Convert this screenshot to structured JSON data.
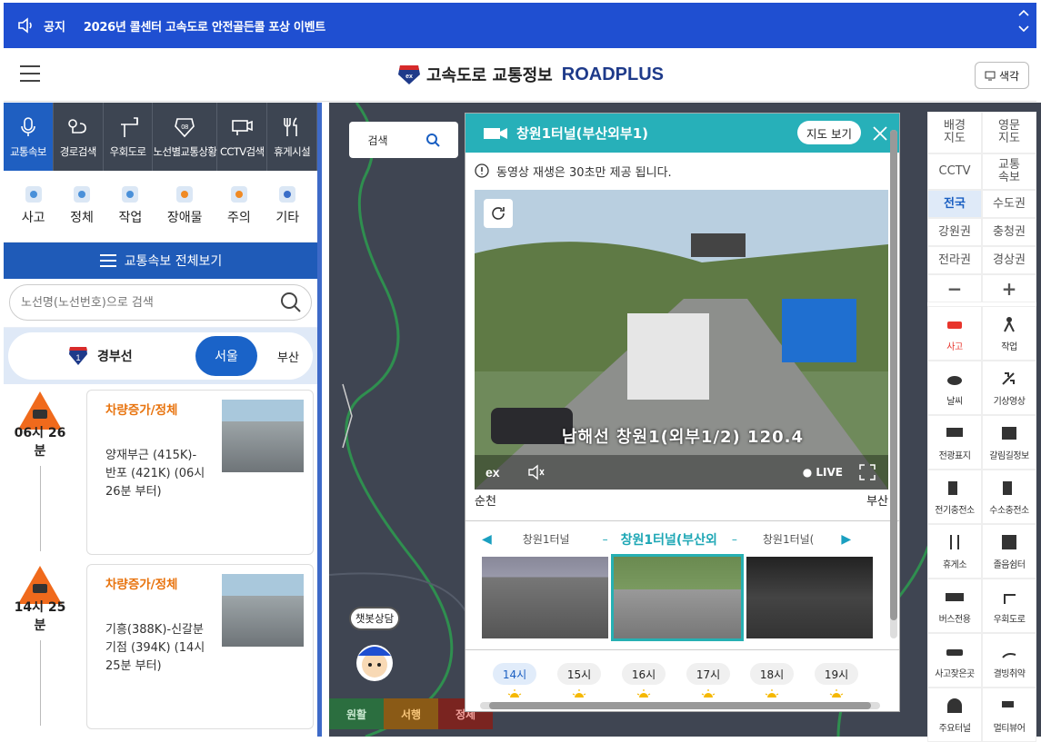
{
  "notice": {
    "label": "공지",
    "text": "2026년 콜센터 고속도로 안전골든콜 포상 이벤트"
  },
  "header": {
    "logo_text": "고속도로 교통정보",
    "logo_brand": "ROADPLUS",
    "color_button": "색각"
  },
  "tabs": [
    {
      "label": "교통속보",
      "icon": "mic-icon"
    },
    {
      "label": "경로검색",
      "icon": "route-icon"
    },
    {
      "label": "우회도로",
      "icon": "detour-icon"
    },
    {
      "label": "노선별교통상황",
      "icon": "route-shield-icon"
    },
    {
      "label": "CCTV검색",
      "icon": "cctv-icon"
    },
    {
      "label": "휴게시설",
      "icon": "restaurant-icon"
    }
  ],
  "types": [
    {
      "label": "사고",
      "color": "#4a90d9"
    },
    {
      "label": "정체",
      "color": "#4a90d9"
    },
    {
      "label": "작업",
      "color": "#4a90d9"
    },
    {
      "label": "장애물",
      "color": "#f08a24"
    },
    {
      "label": "주의",
      "color": "#f08a24"
    },
    {
      "label": "기타",
      "color": "#3a6ec8"
    }
  ],
  "all_button": "교통속보 전체보기",
  "search": {
    "placeholder": "노선명(노선번호)으로 검색"
  },
  "route": {
    "number": "1",
    "name": "경부선",
    "dir_seoul": "서울",
    "dir_busan": "부산"
  },
  "incidents": [
    {
      "time": "06시 26\n분",
      "title": "차량증가/정체",
      "desc": "양재부근 (415K)-반포 (421K) (06시 26분 부터)"
    },
    {
      "time": "14시 25\n분",
      "title": "차량증가/정체",
      "desc": "기흥(388K)-신갈분기점 (394K) (14시 25분 부터)"
    }
  ],
  "popup": {
    "title": "창원1터널(부산외부1)",
    "map_button": "지도 보기",
    "notice": "동영상 재생은 30초만 제공 됩니다.",
    "overlay": "남해선 창원1(외부1/2) 120.4",
    "live": "LIVE",
    "dir_left": "순천",
    "dir_right": "부산",
    "prev_cam": "창원1터널",
    "cur_cam": "창원1터널(부산외",
    "next_cam": "창원1터널(",
    "hours": [
      "14시",
      "15시",
      "16시",
      "17시",
      "18시",
      "19시"
    ]
  },
  "map": {
    "search_label": "검색",
    "chat_button": "챗봇상담",
    "legend": [
      {
        "label": "원활",
        "color": "#2fa84f"
      },
      {
        "label": "서행",
        "color": "#f4a018"
      },
      {
        "label": "정체",
        "color": "#e0302a"
      }
    ]
  },
  "right_panel": {
    "layers": [
      "배경\n지도",
      "영문\n지도",
      "CCTV",
      "교통\n속보",
      "전국",
      "수도권",
      "강원권",
      "충청권",
      "전라권",
      "경상권",
      "−",
      "+"
    ],
    "icons": [
      "사고",
      "작업",
      "날씨",
      "기상영상",
      "전광표지",
      "갈림길정보",
      "전기충전소",
      "수소충전소",
      "휴게소",
      "졸음쉼터",
      "버스전용",
      "우회도로",
      "사고잦은곳",
      "결빙취약",
      "주요터널",
      "멀티뷰어"
    ]
  }
}
